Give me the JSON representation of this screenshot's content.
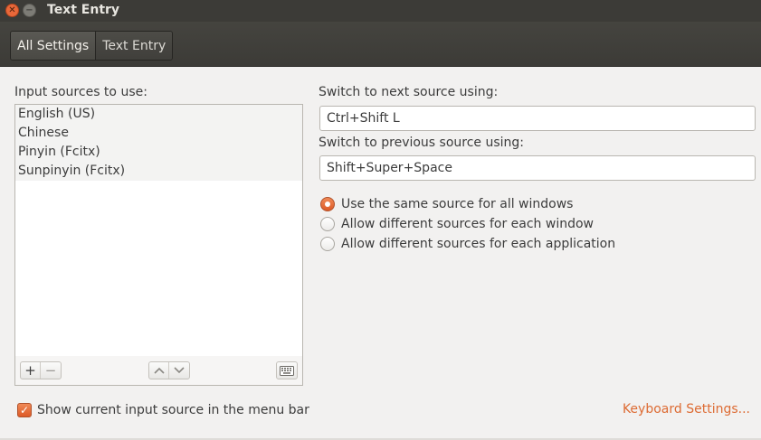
{
  "window": {
    "title": "Text Entry"
  },
  "breadcrumbs": [
    {
      "label": "All Settings"
    },
    {
      "label": "Text Entry"
    }
  ],
  "input_sources": {
    "label": "Input sources to use:",
    "items": [
      "English (US)",
      "Chinese",
      "Pinyin (Fcitx)",
      "Sunpinyin (Fcitx)"
    ],
    "toolbar": {
      "add": "+",
      "remove": "−",
      "up": "⌃",
      "down": "⌄"
    }
  },
  "next_source": {
    "label": "Switch to next source using:",
    "value": "Ctrl+Shift L"
  },
  "prev_source": {
    "label": "Switch to previous source using:",
    "value": "Shift+Super+Space"
  },
  "source_mode": {
    "options": [
      {
        "label": "Use the same source for all windows",
        "checked": true
      },
      {
        "label": "Allow different sources for each window",
        "checked": false
      },
      {
        "label": "Allow different sources for each application",
        "checked": false
      }
    ]
  },
  "show_in_menubar": {
    "label": "Show current input source in the menu bar",
    "checked": true
  },
  "keyboard_settings": {
    "label": "Keyboard Settings..."
  },
  "colors": {
    "accent": "#dd5a27",
    "link": "#dd6b33",
    "titlebar": "#3c3b37",
    "background": "#f2f1f0"
  }
}
